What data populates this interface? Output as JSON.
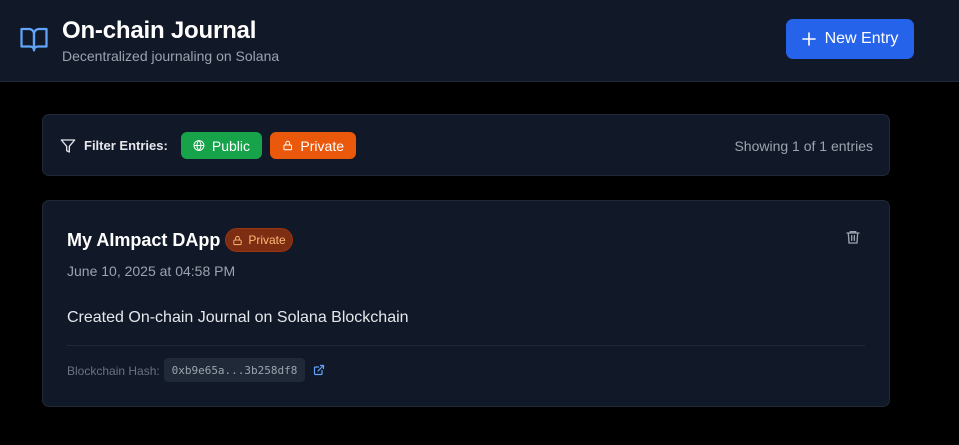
{
  "header": {
    "title": "On-chain Journal",
    "subtitle": "Decentralized journaling on Solana",
    "brand_icon": "book-open-icon",
    "new_entry_label": "New Entry",
    "new_entry_icon": "plus-icon"
  },
  "filter": {
    "label": "Filter Entries:",
    "icon": "filter-icon",
    "chips": [
      {
        "label": "Public",
        "icon": "globe-icon",
        "color": "#16a34a"
      },
      {
        "label": "Private",
        "icon": "lock-icon",
        "color": "#ea580c"
      }
    ],
    "showing_text": "Showing 1 of 1 entries"
  },
  "entries": [
    {
      "title": "My AImpact DApp",
      "visibility": "Private",
      "date": "June 10, 2025 at 04:58 PM",
      "content": "Created On-chain Journal on Solana Blockchain",
      "hash_label": "Blockchain Hash:",
      "hash": "0xb9e65a...3b258df8"
    }
  ],
  "colors": {
    "accent": "#2563eb",
    "public": "#16a34a",
    "private": "#ea580c",
    "background": "#000000",
    "surface": "#111827"
  }
}
